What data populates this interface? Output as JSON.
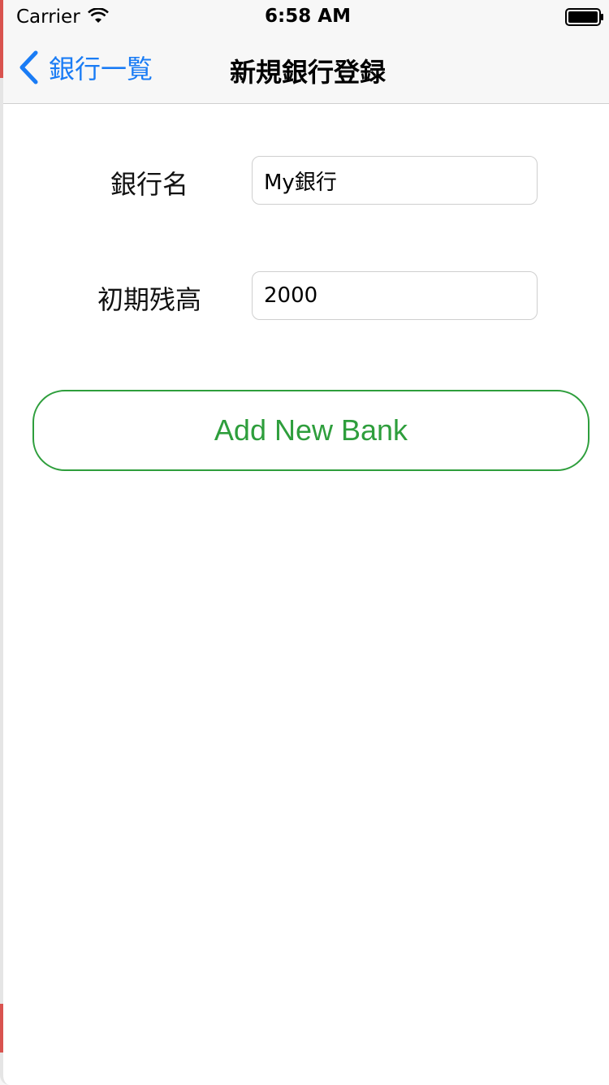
{
  "status_bar": {
    "carrier": "Carrier",
    "time": "6:58 AM",
    "wifi_icon": "wifi-icon",
    "battery_icon": "battery-icon"
  },
  "nav_bar": {
    "back_label": "銀行一覧",
    "back_icon": "chevron-left-icon",
    "title": "新規銀行登録"
  },
  "form": {
    "bank_name": {
      "label": "銀行名",
      "value": "My銀行"
    },
    "initial_balance": {
      "label": "初期残高",
      "value": "2000"
    },
    "submit_label": "Add New Bank"
  },
  "colors": {
    "tint": "#1a7cf5",
    "accent": "#2e9e3c",
    "bar_background": "#f7f7f7"
  }
}
